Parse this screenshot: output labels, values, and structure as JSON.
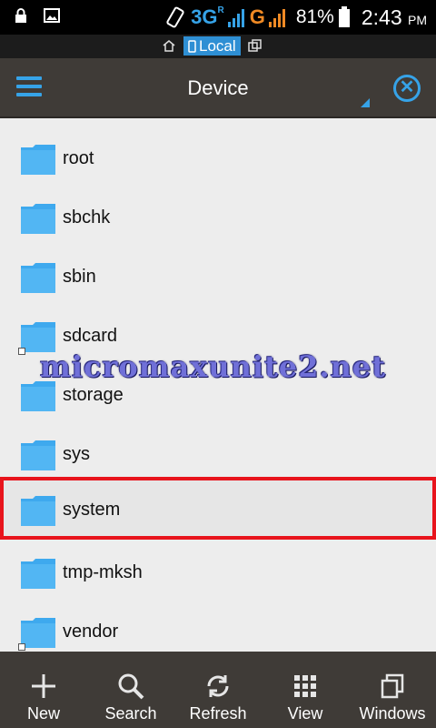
{
  "status_bar": {
    "network_type": "3G",
    "network_type_sup": "R",
    "network_type_2": "G",
    "battery": "81%",
    "time": "2:43",
    "time_suffix": "PM"
  },
  "location": {
    "label": "Local"
  },
  "toolbar": {
    "title": "Device"
  },
  "files": [
    {
      "name": "root",
      "shortcut": false
    },
    {
      "name": "sbchk",
      "shortcut": false
    },
    {
      "name": "sbin",
      "shortcut": false
    },
    {
      "name": "sdcard",
      "shortcut": true
    },
    {
      "name": "storage",
      "shortcut": false
    },
    {
      "name": "sys",
      "shortcut": false
    },
    {
      "name": "system",
      "shortcut": false,
      "selected": true
    },
    {
      "name": "tmp-mksh",
      "shortcut": false
    },
    {
      "name": "vendor",
      "shortcut": true
    }
  ],
  "watermark": "micromaxunite2.net",
  "bottom_bar": {
    "new": "New",
    "search": "Search",
    "refresh": "Refresh",
    "view": "View",
    "windows": "Windows"
  },
  "colors": {
    "accent": "#36a3e8",
    "highlight": "#e8141c",
    "folder": "#3ea9ee"
  }
}
